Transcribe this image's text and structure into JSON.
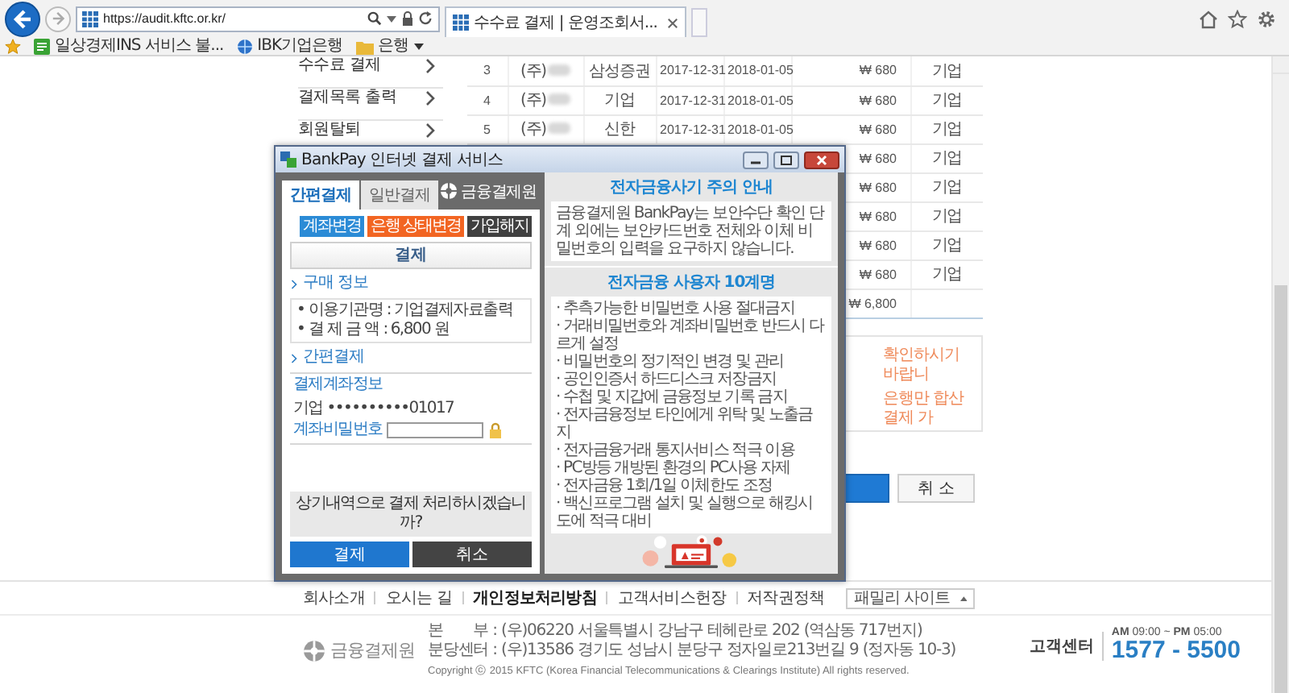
{
  "browser": {
    "address": "https://audit.kftc.or.kr/",
    "tab_title": "수수료 결제 | 운영조회서...",
    "favorites": [
      {
        "kind": "page",
        "label": "일상경제INS 서비스 불..."
      },
      {
        "kind": "web",
        "label": "IBK기업은행"
      },
      {
        "kind": "folder",
        "label": "은행"
      }
    ]
  },
  "sidebar": {
    "items": [
      {
        "label": "수수료 결제"
      },
      {
        "label": "결제목록 출력"
      },
      {
        "label": "회원탈퇴"
      }
    ]
  },
  "table": {
    "rows": [
      {
        "column_1": "3",
        "column_2": "(주)",
        "column_3": "삼성증권",
        "column_4": "2017-12-31",
        "column_5": "2018-01-05",
        "column_6": "₩ 680",
        "column_7": "기업"
      },
      {
        "column_1": "4",
        "column_2": "(주)",
        "column_3": "기업",
        "column_4": "2017-12-31",
        "column_5": "2018-01-05",
        "column_6": "₩ 680",
        "column_7": "기업"
      },
      {
        "column_1": "5",
        "column_2": "(주)",
        "column_3": "신한",
        "column_4": "2017-12-31",
        "column_5": "2018-01-05",
        "column_6": "₩ 680",
        "column_7": "기업"
      },
      {
        "column_6": "₩ 680",
        "column_7": "기업"
      },
      {
        "column_6": "₩ 680",
        "column_7": "기업"
      },
      {
        "column_6": "₩ 680",
        "column_7": "기업"
      },
      {
        "column_6": "₩ 680",
        "column_7": "기업"
      },
      {
        "column_6": "₩ 680",
        "column_7": "기업"
      }
    ],
    "total": "₩ 6,800"
  },
  "notice": {
    "lines": [
      "확인하시기 바랍니",
      "은행만 합산 결제 가"
    ]
  },
  "actions": [
    {
      "kind": "primary"
    },
    {
      "kind": "secondary",
      "label": "취 소"
    }
  ],
  "dialog": {
    "title": "BankPay 인터넷 결제 서비스",
    "tabs": [
      {
        "label": "간편결제",
        "selected": true
      },
      {
        "label": "일반결제",
        "selected": false
      }
    ],
    "brand": "금융결제원",
    "account_buttons": [
      {
        "label": "계좌변경",
        "color": "#2b8bd6"
      },
      {
        "label": "은행 상태변경",
        "color": "#f26522"
      },
      {
        "label": "가입해지",
        "color": "#404040"
      }
    ],
    "section_header": "결제",
    "purchase": {
      "title": "구매 정보",
      "fields": [
        {
          "label": "• 이용기관명 :",
          "value": "기업결제자료출력"
        },
        {
          "label": "• 결 제 금 액 :",
          "value": "6,800 원"
        }
      ]
    },
    "payment": {
      "title": "간편결제",
      "rows": [
        {
          "kind": "text",
          "label": "결제계좌정보",
          "value": "기업 ••••••••••01017"
        },
        {
          "kind": "password",
          "label": "계좌비밀번호"
        }
      ]
    },
    "confirm_question": "상기내역으로 결제 처리하시겠습니까?",
    "buttons": [
      {
        "kind": "primary",
        "label": "결제"
      },
      {
        "kind": "secondary",
        "label": "취소"
      }
    ],
    "warning": {
      "title": "전자금융사기 주의 안내",
      "text": "금융결제원 BankPay는 보안수단 확인 단계 외에는 보안카드번호 전체와 이체 비밀번호의 입력을 요구하지 않습니다."
    },
    "rules": {
      "title": "전자금융 사용자 10계명",
      "items": [
        "· 추측가능한 비밀번호 사용 절대금지",
        "· 거래비밀번호와 계좌비밀번호 반드시 다르게 설정",
        "· 비밀번호의 정기적인 변경 및 관리",
        "· 공인인증서 하드디스크 저장금지",
        "· 수첩 및 지갑에 금융정보 기록 금지",
        "· 전자금융정보 타인에게 위탁 및 노출금지",
        "· 전자금융거래 통지서비스 적극 이용",
        "· PC방등 개방된 환경의 PC사용 자제",
        "· 전자금융 1회/1일 이체한도 조정",
        "· 백신프로그램 설치 및 실행으로 해킹시도에 적극 대비"
      ]
    }
  },
  "footer": {
    "links": [
      {
        "label": "회사소개",
        "bold": false
      },
      {
        "label": "오시는 길",
        "bold": false
      },
      {
        "label": "개인정보처리방침",
        "bold": true
      },
      {
        "label": "고객서비스헌장",
        "bold": false
      },
      {
        "label": "저작권정책",
        "bold": false
      }
    ],
    "family_site": "패밀리 사이트",
    "brand": "금융결제원",
    "address": [
      "본　　부 : (우)06220 서울특별시 강남구 테헤란로 202 (역삼동 717번지)",
      "분당센터 : (우)13586 경기도 성남시 분당구 정자일로213번길 9 (정자동 10-3)"
    ],
    "copyright": "Copyright ⓒ 2015 KFTC (Korea Financial Telecommunications & Clearings Institute) All rights reserved.",
    "service_center": {
      "label": "고객센터",
      "hours": "**AM** 09:00 ~ **PM** 05:00",
      "phone": "1577 - 5500"
    }
  }
}
